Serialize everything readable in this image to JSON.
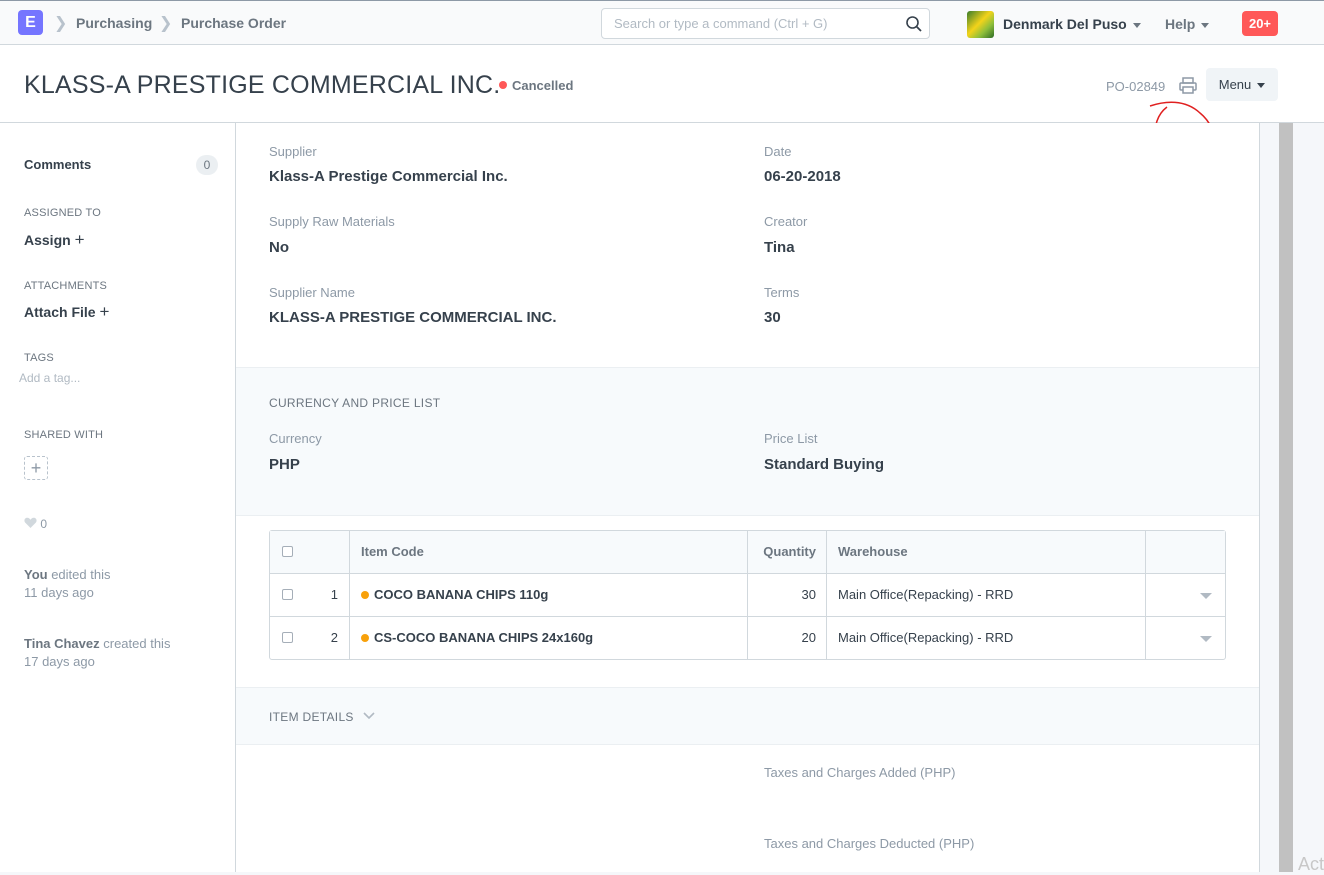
{
  "navbar": {
    "brand": "E",
    "breadcrumbs": [
      "Purchasing",
      "Purchase Order"
    ],
    "search_placeholder": "Search or type a command (Ctrl + G)",
    "user_name": "Denmark Del Puso",
    "help_label": "Help",
    "notifications": "20+"
  },
  "header": {
    "title": "KLASS-A PRESTIGE COMMERCIAL INC.",
    "status": "Cancelled",
    "status_color": "#ff5858",
    "doc_name": "PO-02849",
    "menu_label": "Menu"
  },
  "sidebar": {
    "comments_label": "Comments",
    "comments_count": "0",
    "assigned_to_label": "ASSIGNED TO",
    "assign_label": "Assign",
    "attachments_label": "ATTACHMENTS",
    "attach_label": "Attach File",
    "tags_label": "TAGS",
    "tag_placeholder": "Add a tag...",
    "shared_label": "SHARED WITH",
    "likes": "0",
    "activity": [
      {
        "who": "You",
        "what": " edited this",
        "when": "11 days ago"
      },
      {
        "who": "Tina Chavez",
        "what": " created this",
        "when": "17 days ago"
      }
    ]
  },
  "form": {
    "supplier_label": "Supplier",
    "supplier": "Klass-A Prestige Commercial Inc.",
    "date_label": "Date",
    "date": "06-20-2018",
    "supply_raw_label": "Supply Raw Materials",
    "supply_raw": "No",
    "creator_label": "Creator",
    "creator": "Tina",
    "supplier_name_label": "Supplier Name",
    "supplier_name": "KLASS-A PRESTIGE COMMERCIAL INC.",
    "terms_label": "Terms",
    "terms": "30",
    "currency_section": "CURRENCY AND PRICE LIST",
    "currency_label": "Currency",
    "currency": "PHP",
    "price_list_label": "Price List",
    "price_list": "Standard Buying",
    "item_details_section": "ITEM DETAILS",
    "taxes_added_label": "Taxes and Charges Added (PHP)",
    "taxes_deducted_label": "Taxes and Charges Deducted (PHP)"
  },
  "items_table": {
    "columns": [
      "Item Code",
      "Quantity",
      "Warehouse"
    ],
    "rows": [
      {
        "idx": "1",
        "item_code": "COCO BANANA CHIPS 110g",
        "qty": "30",
        "warehouse": "Main Office(Repacking) - RRD"
      },
      {
        "idx": "2",
        "item_code": "CS-COCO BANANA CHIPS 24x160g",
        "qty": "20",
        "warehouse": "Main Office(Repacking) - RRD"
      }
    ]
  },
  "watermark": "Act"
}
